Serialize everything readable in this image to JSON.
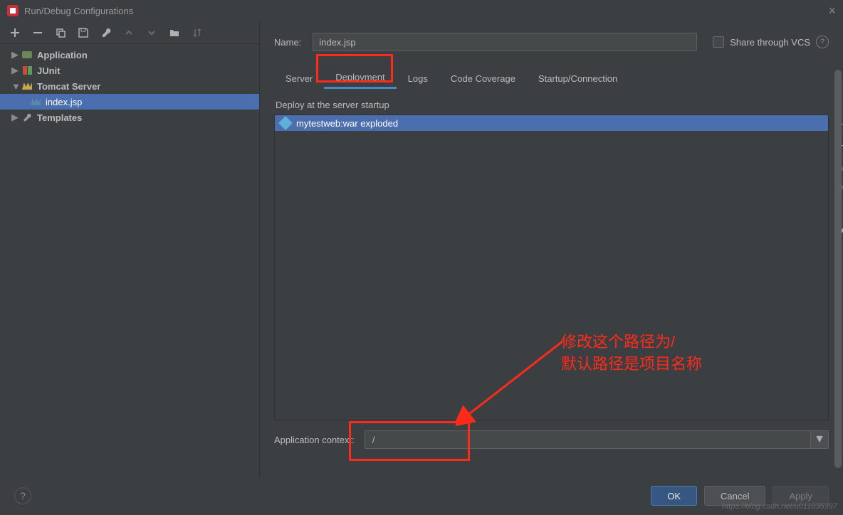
{
  "window": {
    "title": "Run/Debug Configurations"
  },
  "sidebar": {
    "items": [
      {
        "label": "Application"
      },
      {
        "label": "JUnit"
      },
      {
        "label": "Tomcat Server"
      },
      {
        "label": "index.jsp"
      },
      {
        "label": "Templates"
      }
    ]
  },
  "form": {
    "name_label": "Name:",
    "name_value": "index.jsp",
    "vcs_label": "Share through VCS"
  },
  "tabs": [
    {
      "label": "Server"
    },
    {
      "label": "Deployment"
    },
    {
      "label": "Logs"
    },
    {
      "label": "Code Coverage"
    },
    {
      "label": "Startup/Connection"
    }
  ],
  "panel": {
    "heading": "Deploy at the server startup",
    "artifact": "mytestweb:war exploded",
    "context_label": "Application context:",
    "context_value": "/"
  },
  "footer": {
    "ok": "OK",
    "cancel": "Cancel",
    "apply": "Apply"
  },
  "annotation": {
    "line1": "修改这个路径为/",
    "line2": "默认路径是项目名称"
  },
  "watermark": "https://blog.csdn.net/u011035397"
}
